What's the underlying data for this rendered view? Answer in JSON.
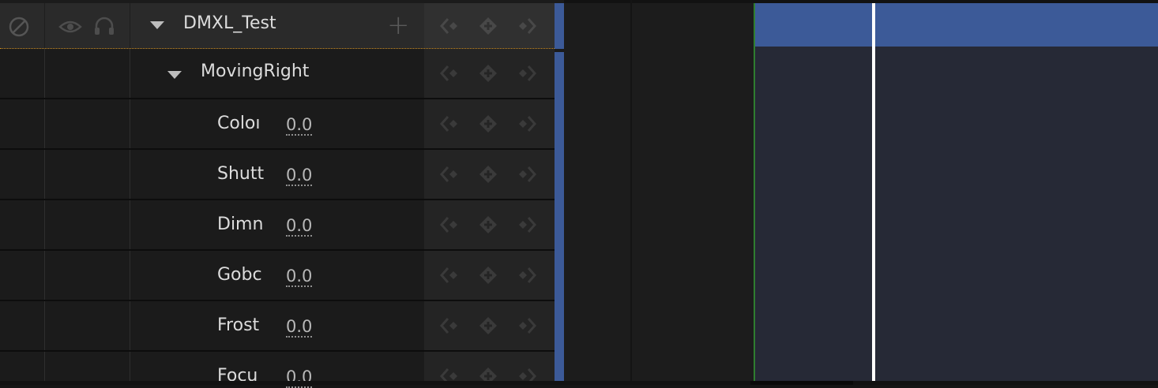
{
  "track": {
    "name": "DMXL_Test",
    "add_label": "+",
    "group": {
      "name": "MovingRight",
      "channels": [
        {
          "label": "Coloı",
          "value": "0.0"
        },
        {
          "label": "Shutt",
          "value": "0.0"
        },
        {
          "label": "Dimn",
          "value": "0.0"
        },
        {
          "label": "Gobc",
          "value": "0.0"
        },
        {
          "label": "Frost",
          "value": "0.0"
        },
        {
          "label": "Focu",
          "value": "0.0"
        }
      ]
    }
  },
  "icons": {
    "mute": "disabled-circle-icon",
    "visibility": "eye-icon",
    "solo": "headphones-icon",
    "expand": "triangle-down-icon",
    "prev_key": "previous-key-icon",
    "add_key": "add-key-icon",
    "next_key": "next-key-icon"
  },
  "colors": {
    "section": "#3c5a98",
    "playhead": "#ffffff",
    "selection_outline": "#c8891e"
  }
}
